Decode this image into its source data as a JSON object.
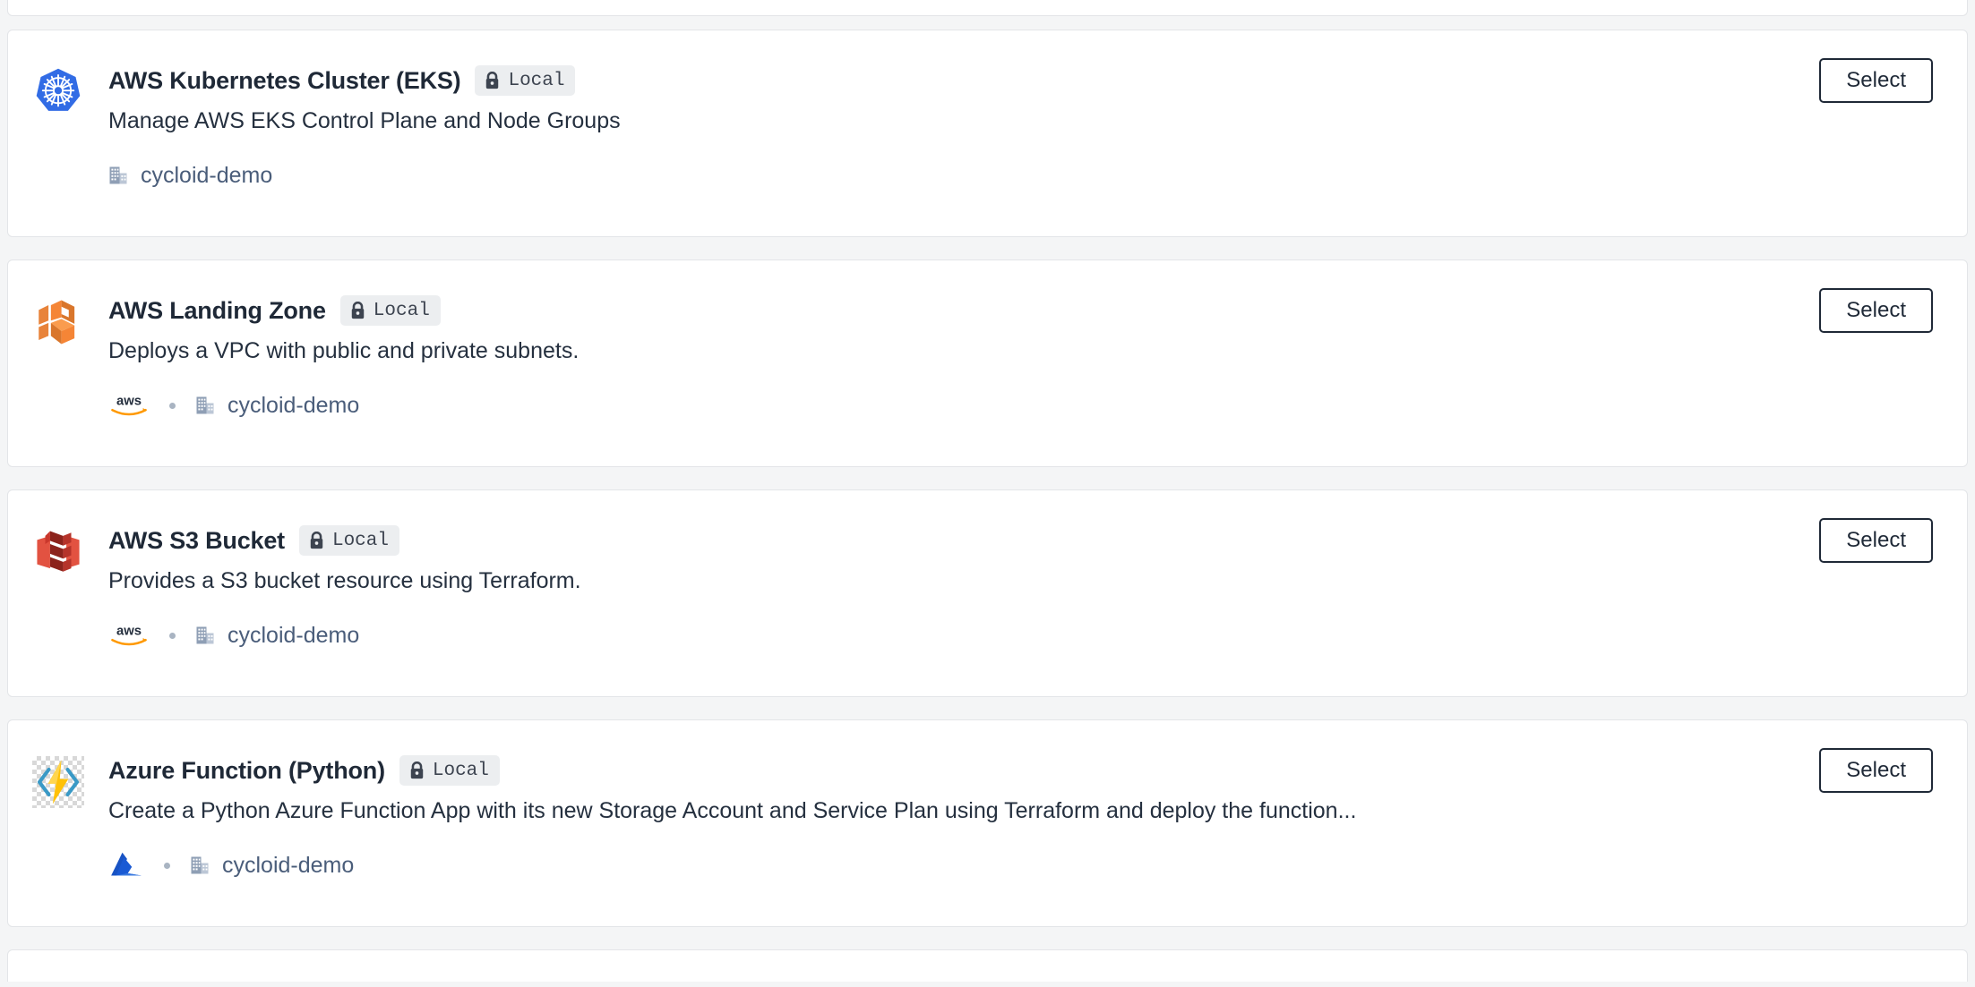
{
  "page": {
    "background_color": "#f4f5f6",
    "card_background": "#ffffff",
    "card_border_color": "#e3e5e8",
    "title_color": "#1f2937",
    "org_link_color": "#4a5d7a"
  },
  "badge": {
    "label": "Local",
    "icon": "lock-icon",
    "background_color": "#eceef0",
    "text_color": "#3d4450"
  },
  "action": {
    "select_label": "Select"
  },
  "stacks": [
    {
      "title": "AWS Kubernetes Cluster (EKS)",
      "badge_label": "Local",
      "description": "Manage AWS EKS Control Plane and Node Groups",
      "service_icon": "kubernetes-icon",
      "provider_icon": null,
      "provider_name": null,
      "org_icon": "building-icon",
      "org_name": "cycloid-demo",
      "select_label": "Select"
    },
    {
      "title": "AWS Landing Zone",
      "badge_label": "Local",
      "description": "Deploys a VPC with public and private subnets.",
      "service_icon": "aws-service-cube-icon",
      "provider_icon": "aws-logo-icon",
      "provider_name": "aws",
      "org_icon": "building-icon",
      "org_name": "cycloid-demo",
      "select_label": "Select"
    },
    {
      "title": "AWS S3 Bucket",
      "badge_label": "Local",
      "description": "Provides a S3 bucket resource using Terraform.",
      "service_icon": "aws-s3-icon",
      "provider_icon": "aws-logo-icon",
      "provider_name": "aws",
      "org_icon": "building-icon",
      "org_name": "cycloid-demo",
      "select_label": "Select"
    },
    {
      "title": "Azure Function (Python)",
      "badge_label": "Local",
      "description": "Create a Python Azure Function App with its new Storage Account and Service Plan using Terraform and deploy the function...",
      "service_icon": "azure-functions-icon",
      "provider_icon": "azure-logo-icon",
      "provider_name": "Azure",
      "org_icon": "building-icon",
      "org_name": "cycloid-demo",
      "select_label": "Select"
    }
  ]
}
